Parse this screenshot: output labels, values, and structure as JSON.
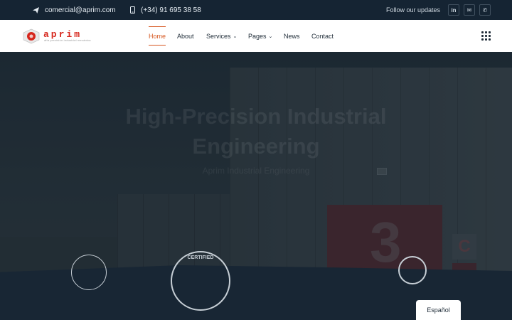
{
  "topbar": {
    "email": "comercial@aprim.com",
    "phone": "(+34) 91 695 38 58",
    "follow_text": "Follow our updates",
    "social": [
      {
        "name": "linkedin-icon",
        "label": "in"
      },
      {
        "name": "mail-icon",
        "label": "✉"
      },
      {
        "name": "phone-icon",
        "label": "✆"
      }
    ]
  },
  "header": {
    "logo_text": "aprim",
    "logo_subtext": "alta precisión industrial mecánica",
    "nav": [
      {
        "label": "Home",
        "active": true
      },
      {
        "label": "About"
      },
      {
        "label": "Services",
        "has_dropdown": true
      },
      {
        "label": "Pages",
        "has_dropdown": true
      },
      {
        "label": "News"
      },
      {
        "label": "Contact"
      }
    ]
  },
  "hero": {
    "title": "High-Precision Industrial Engineering",
    "subtitle": "Aprim Industrial Engineering",
    "building_number": "3",
    "sign_letter": "C"
  },
  "certifications": {
    "badge_2_text": "CERTIFIED"
  },
  "language_button": "Español",
  "colors": {
    "topbar_bg": "#152433",
    "accent": "#d6571f",
    "logo_red": "#d6261c",
    "hero_bg": "#1b2836"
  }
}
